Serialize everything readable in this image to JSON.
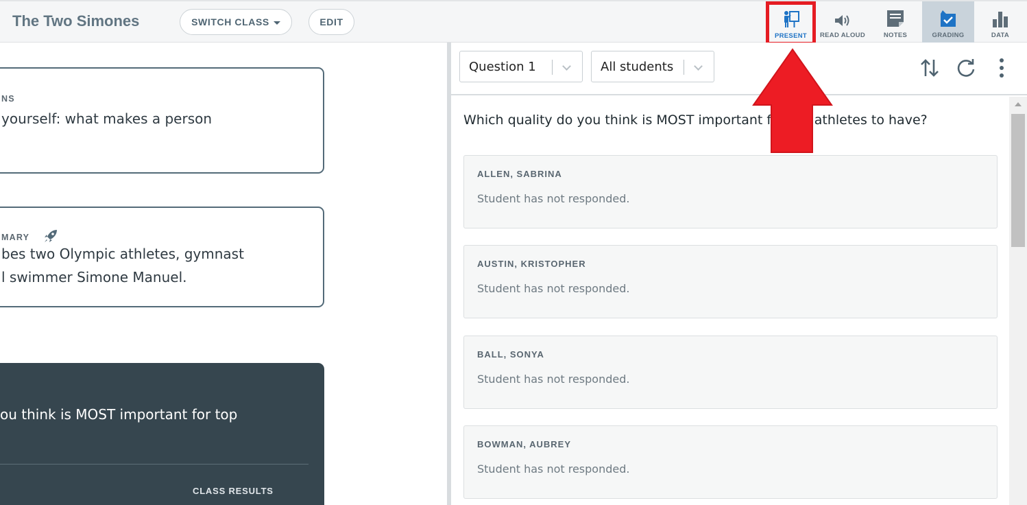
{
  "header": {
    "title": "The Two Simones",
    "switch_class_label": "SWITCH CLASS",
    "edit_label": "EDIT",
    "tools": {
      "present": "PRESENT",
      "read_aloud": "READ ALOUD",
      "notes": "NOTES",
      "grading": "GRADING",
      "data": "DATA"
    },
    "active_tool": "grading",
    "highlighted_tool": "present"
  },
  "left": {
    "card1": {
      "label": "NS",
      "text": "yourself: what makes a person"
    },
    "card2": {
      "label": "MARY",
      "line1": "bes two Olympic athletes, gymnast",
      "line2": "l swimmer Simone Manuel."
    },
    "question_card": {
      "text": "ou think is MOST important for top",
      "results_label": "CLASS RESULTS"
    }
  },
  "right": {
    "question_select": "Question 1",
    "students_select": "All students",
    "question_text": "Which quality do you think is MOST important for top athletes to have?",
    "responses": [
      {
        "name": "ALLEN, SABRINA",
        "status": "Student has not responded."
      },
      {
        "name": "AUSTIN, KRISTOPHER",
        "status": "Student has not responded."
      },
      {
        "name": "BALL, SONYA",
        "status": "Student has not responded."
      },
      {
        "name": "BOWMAN, AUBREY",
        "status": "Student has not responded."
      }
    ]
  },
  "colors": {
    "accent_blue": "#1e73c5",
    "highlight_red": "#e51c23",
    "header_bg": "#f5f6f7",
    "dark_card": "#36464f"
  },
  "icons": [
    "present-icon",
    "read-aloud-icon",
    "notes-icon",
    "grading-icon",
    "data-icon",
    "sort-icon",
    "refresh-icon",
    "more-icon",
    "rocket-icon",
    "chevron-down-icon"
  ]
}
